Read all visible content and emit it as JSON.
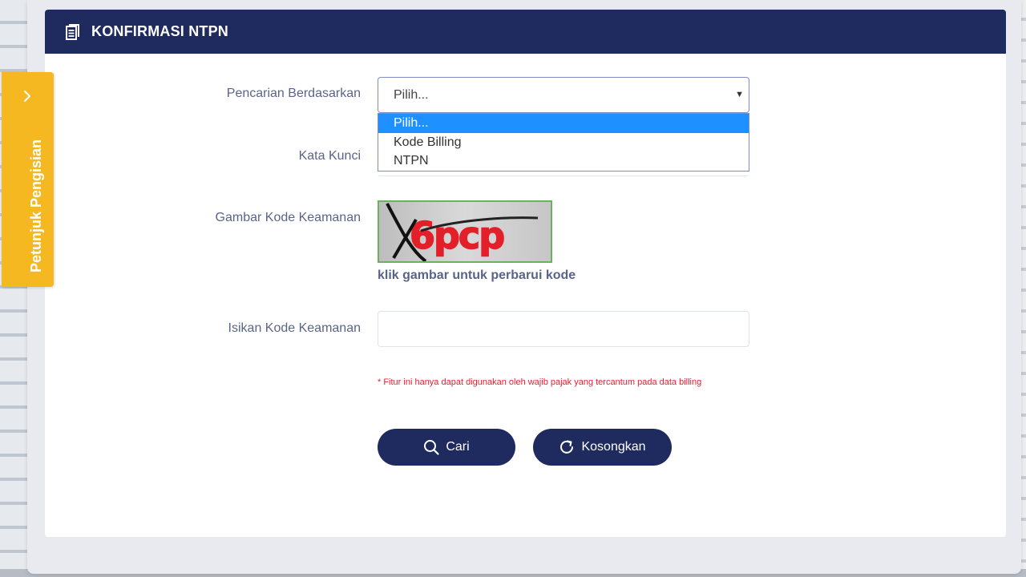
{
  "header": {
    "title": "KONFIRMASI NTPN",
    "icon": "document-icon"
  },
  "side_tab": {
    "label": "Petunjuk Pengisian",
    "icon": "chevron-right-icon",
    "color": "#f5b820"
  },
  "form": {
    "search_by_label": "Pencarian Berdasarkan",
    "search_by_value": "Pilih...",
    "search_by_options": [
      "Pilih...",
      "Kode Billing",
      "NTPN"
    ],
    "search_by_highlighted": "Pilih...",
    "keyword_label": "Kata Kunci",
    "captcha_label": "Gambar Kode Keamanan",
    "captcha_text": "6pcp",
    "captcha_hint": "klik gambar untuk perbarui kode",
    "security_code_label": "Isikan Kode Keamanan",
    "security_code_value": "",
    "note": "* Fitur ini hanya dapat digunakan oleh wajib pajak yang tercantum pada data billing"
  },
  "buttons": {
    "search_label": "Cari",
    "search_icon": "search-icon",
    "reset_label": "Kosongkan",
    "reset_icon": "refresh-icon"
  },
  "colors": {
    "primary": "#1f2b5e",
    "accent_highlight": "#1e90ff",
    "warning_text": "#e8202e"
  }
}
